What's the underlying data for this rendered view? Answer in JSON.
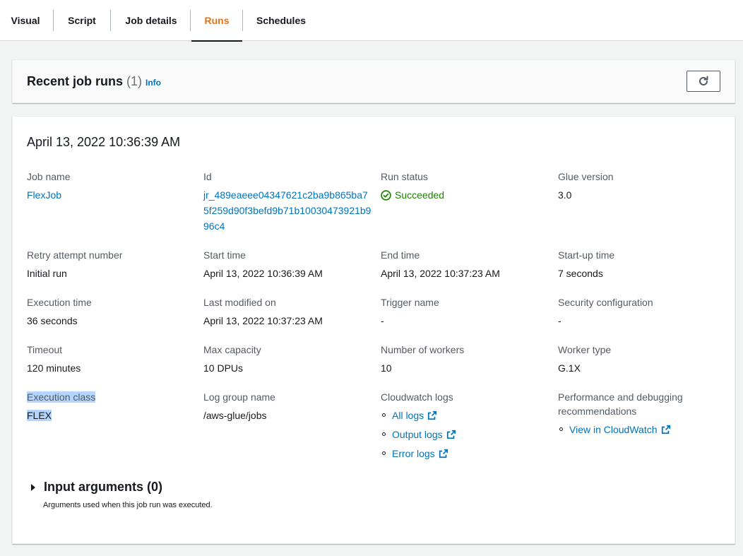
{
  "tabs": [
    {
      "label": "Visual"
    },
    {
      "label": "Script"
    },
    {
      "label": "Job details"
    },
    {
      "label": "Runs"
    },
    {
      "label": "Schedules"
    }
  ],
  "active_tab": "Runs",
  "header": {
    "title": "Recent job runs",
    "count": "(1)",
    "info": "Info",
    "refresh_icon": "refresh-icon"
  },
  "run": {
    "timestamp": "April 13, 2022 10:36:39 AM",
    "job_name": {
      "label": "Job name",
      "value": "FlexJob"
    },
    "id": {
      "label": "Id",
      "value": "jr_489eaeee04347621c2ba9b865ba75f259d90f3befd9b71b10030473921b996c4"
    },
    "run_status": {
      "label": "Run status",
      "value": "Succeeded",
      "icon": "check-circle-icon",
      "color": "#1d8102"
    },
    "glue_version": {
      "label": "Glue version",
      "value": "3.0"
    },
    "retry_attempt": {
      "label": "Retry attempt number",
      "value": "Initial run"
    },
    "start_time": {
      "label": "Start time",
      "value": "April 13, 2022 10:36:39 AM"
    },
    "end_time": {
      "label": "End time",
      "value": "April 13, 2022 10:37:23 AM"
    },
    "startup_time": {
      "label": "Start-up time",
      "value": "7 seconds"
    },
    "execution_time": {
      "label": "Execution time",
      "value": "36 seconds"
    },
    "last_modified": {
      "label": "Last modified on",
      "value": "April 13, 2022 10:37:23 AM"
    },
    "trigger_name": {
      "label": "Trigger name",
      "value": "-"
    },
    "security_config": {
      "label": "Security configuration",
      "value": "-"
    },
    "timeout": {
      "label": "Timeout",
      "value": "120 minutes"
    },
    "max_capacity": {
      "label": "Max capacity",
      "value": "10 DPUs"
    },
    "num_workers": {
      "label": "Number of workers",
      "value": "10"
    },
    "worker_type": {
      "label": "Worker type",
      "value": "G.1X"
    },
    "execution_class": {
      "label": "Execution class",
      "value": "FLEX"
    },
    "log_group": {
      "label": "Log group name",
      "value": "/aws-glue/jobs"
    },
    "cloudwatch_logs": {
      "label": "Cloudwatch logs",
      "links": [
        "All logs",
        "Output logs",
        "Error logs"
      ]
    },
    "performance": {
      "label": "Performance and debugging recommendations",
      "links": [
        "View in CloudWatch"
      ]
    }
  },
  "input_arguments": {
    "title": "Input arguments (0)",
    "description": "Arguments used when this job run was executed."
  },
  "colors": {
    "accent": "#ec7211",
    "link": "#0073bb",
    "success": "#1d8102",
    "highlight": "#b4d5fe"
  }
}
